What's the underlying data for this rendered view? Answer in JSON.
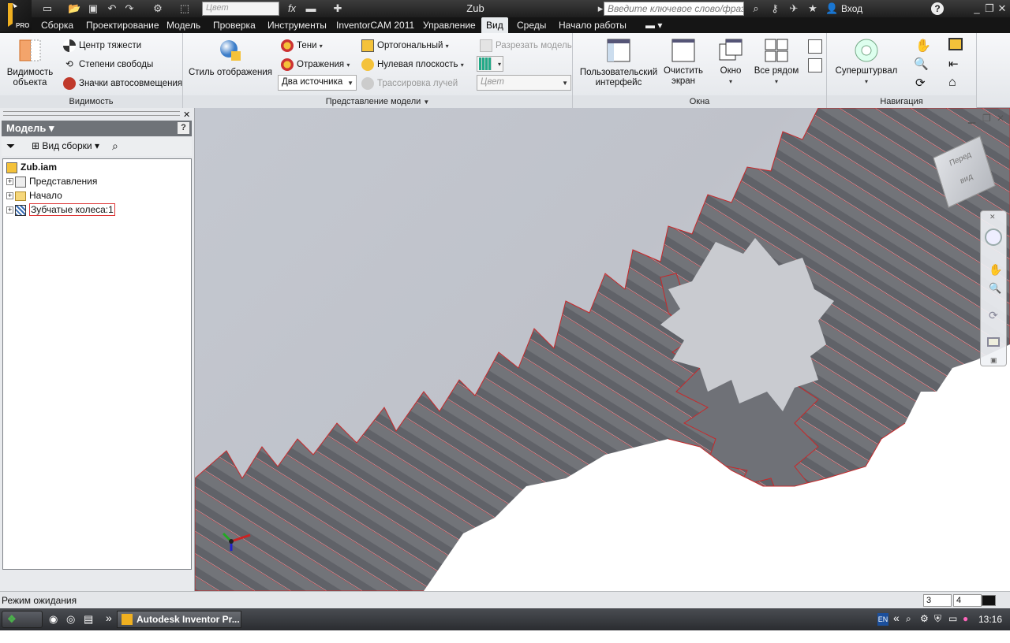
{
  "app": {
    "title": "Zub",
    "logo_badge": "PRO"
  },
  "quick_access": {
    "color_placeholder": "Цвет",
    "search_placeholder": "Введите ключевое слово/фразу",
    "login_label": "Вход",
    "help_label": "?"
  },
  "menu_tabs": [
    {
      "label": "Сборка"
    },
    {
      "label": "Проектирование"
    },
    {
      "label": "Модель"
    },
    {
      "label": "Проверка"
    },
    {
      "label": "Инструменты"
    },
    {
      "label": "InventorCAM 2011"
    },
    {
      "label": "Управление"
    },
    {
      "label": "Вид"
    },
    {
      "label": "Среды"
    },
    {
      "label": "Начало работы"
    }
  ],
  "active_tab": "Вид",
  "ribbon": {
    "visibility": {
      "big_button": "Видимость объекта",
      "items": [
        "Центр тяжести",
        "Степени свободы",
        "Значки автосовмещения"
      ],
      "panel_label": "Видимость"
    },
    "model_view": {
      "display_style": "Стиль отображения",
      "shadows": "Тени",
      "reflections": "Отражения",
      "light_source": "Два источника",
      "orthographic": "Ортогональный",
      "ground_plane": "Нулевая плоскость",
      "ray_tracing": "Трассировка лучей",
      "section": "Разрезать модель",
      "color": "Цвет",
      "panel_label": "Представление модели"
    },
    "windows": {
      "user_interface": "Пользовательский интерфейс",
      "clean_screen": "Очистить экран",
      "window": "Окно",
      "tile": "Все рядом",
      "panel_label": "Окна"
    },
    "navigation": {
      "steering": "Суперштурвал",
      "panel_label": "Навигация"
    }
  },
  "browser": {
    "header": "Модель",
    "view_label": "Вид сборки",
    "tree": [
      {
        "label": "Zub.iam"
      },
      {
        "label": "Представления"
      },
      {
        "label": "Начало"
      },
      {
        "label": "Зубчатые колеса:1"
      }
    ]
  },
  "viewcube": {
    "front": "Перед",
    "right": "вид"
  },
  "status": {
    "message": "Режим ожидания",
    "count_a": "3",
    "count_b": "4"
  },
  "taskbar": {
    "start": "Пуск",
    "task": "Autodesk Inventor Pr...",
    "lang": "EN",
    "time": "13:16"
  }
}
